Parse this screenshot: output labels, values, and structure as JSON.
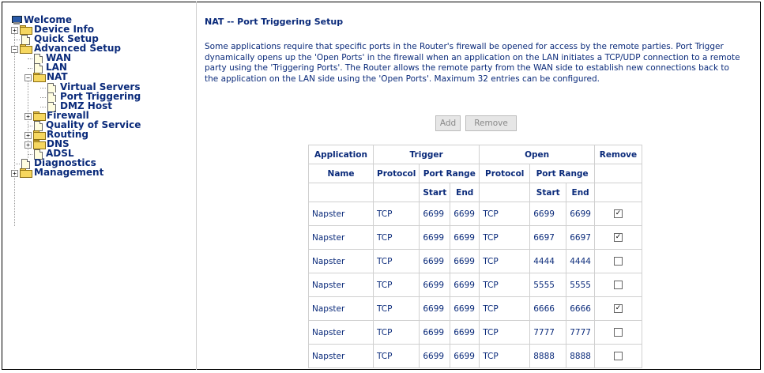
{
  "sidebar": {
    "items": [
      {
        "label": "Welcome"
      },
      {
        "label": "Device Info"
      },
      {
        "label": "Quick Setup"
      },
      {
        "label": "Advanced Setup"
      },
      {
        "label": "WAN"
      },
      {
        "label": "LAN"
      },
      {
        "label": "NAT"
      },
      {
        "label": "Virtual Servers"
      },
      {
        "label": "Port Triggering"
      },
      {
        "label": "DMZ Host"
      },
      {
        "label": "Firewall"
      },
      {
        "label": "Quality of Service"
      },
      {
        "label": "Routing"
      },
      {
        "label": "DNS"
      },
      {
        "label": "ADSL"
      },
      {
        "label": "Diagnostics"
      },
      {
        "label": "Management"
      }
    ],
    "expand_symbols": {
      "plus": "+",
      "minus": "−"
    }
  },
  "page": {
    "title": "NAT -- Port Triggering Setup",
    "description": "Some applications require that specific ports in the Router's firewall be opened for access by the remote parties. Port Trigger dynamically opens up the 'Open Ports' in the firewall when an application on the LAN initiates a TCP/UDP connection to a remote party using the 'Triggering Ports'. The Router allows the remote party from the WAN side to establish new connections back to the application on the LAN side using the 'Open Ports'. Maximum 32 entries can be configured."
  },
  "buttons": {
    "add": "Add",
    "remove": "Remove"
  },
  "table": {
    "group_headers": {
      "application": "Application",
      "trigger": "Trigger",
      "open": "Open",
      "remove": "Remove"
    },
    "sub_headers": {
      "name": "Name",
      "protocol": "Protocol",
      "port_range": "Port Range",
      "protocol2": "Protocol",
      "port_range2": "Port Range"
    },
    "range_headers": {
      "start": "Start",
      "end": "End",
      "start2": "Start",
      "end2": "End"
    },
    "rows": [
      {
        "name": "Napster",
        "t_proto": "TCP",
        "t_start": "6699",
        "t_end": "6699",
        "o_proto": "TCP",
        "o_start": "6699",
        "o_end": "6699",
        "remove": true
      },
      {
        "name": "Napster",
        "t_proto": "TCP",
        "t_start": "6699",
        "t_end": "6699",
        "o_proto": "TCP",
        "o_start": "6697",
        "o_end": "6697",
        "remove": true
      },
      {
        "name": "Napster",
        "t_proto": "TCP",
        "t_start": "6699",
        "t_end": "6699",
        "o_proto": "TCP",
        "o_start": "4444",
        "o_end": "4444",
        "remove": false
      },
      {
        "name": "Napster",
        "t_proto": "TCP",
        "t_start": "6699",
        "t_end": "6699",
        "o_proto": "TCP",
        "o_start": "5555",
        "o_end": "5555",
        "remove": false
      },
      {
        "name": "Napster",
        "t_proto": "TCP",
        "t_start": "6699",
        "t_end": "6699",
        "o_proto": "TCP",
        "o_start": "6666",
        "o_end": "6666",
        "remove": true
      },
      {
        "name": "Napster",
        "t_proto": "TCP",
        "t_start": "6699",
        "t_end": "6699",
        "o_proto": "TCP",
        "o_start": "7777",
        "o_end": "7777",
        "remove": false
      },
      {
        "name": "Napster",
        "t_proto": "TCP",
        "t_start": "6699",
        "t_end": "6699",
        "o_proto": "TCP",
        "o_start": "8888",
        "o_end": "8888",
        "remove": false
      }
    ],
    "check_mark": "✓"
  }
}
